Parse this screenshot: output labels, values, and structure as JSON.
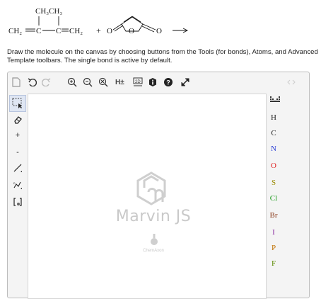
{
  "reaction": {
    "substituent": "CH₃CH₃",
    "diene_left": "CH₂",
    "diene_c1": "C",
    "diene_c2": "C",
    "diene_right": "CH₂",
    "plus": "+",
    "ring_o_left": "O",
    "ring_o_center": "O",
    "ring_o_right": "O"
  },
  "instructions": "Draw the molecule on the canvas by choosing buttons from the Tools (for bonds), Atoms, and Advanced Template toolbars. The single bond is active by default.",
  "editor": {
    "watermark_name": "Marvin JS",
    "watermark_vendor": "ChemAxon",
    "top_toolbar": {
      "h_toggle": "H±",
      "view_2d": "2D"
    },
    "left_toolbar": {
      "plus": "+",
      "minus": "-"
    },
    "atoms": [
      {
        "symbol": "H",
        "color": "#222222"
      },
      {
        "symbol": "C",
        "color": "#222222"
      },
      {
        "symbol": "N",
        "color": "#2b3fd6"
      },
      {
        "symbol": "O",
        "color": "#e02020"
      },
      {
        "symbol": "S",
        "color": "#9a8a00"
      },
      {
        "symbol": "Cl",
        "color": "#1a9a1a"
      },
      {
        "symbol": "Br",
        "color": "#8a3a1a"
      },
      {
        "symbol": "I",
        "color": "#8a2aa0"
      },
      {
        "symbol": "P",
        "color": "#c07000"
      },
      {
        "symbol": "F",
        "color": "#5a8a00"
      }
    ],
    "accent_color": "#e8e8e8"
  }
}
